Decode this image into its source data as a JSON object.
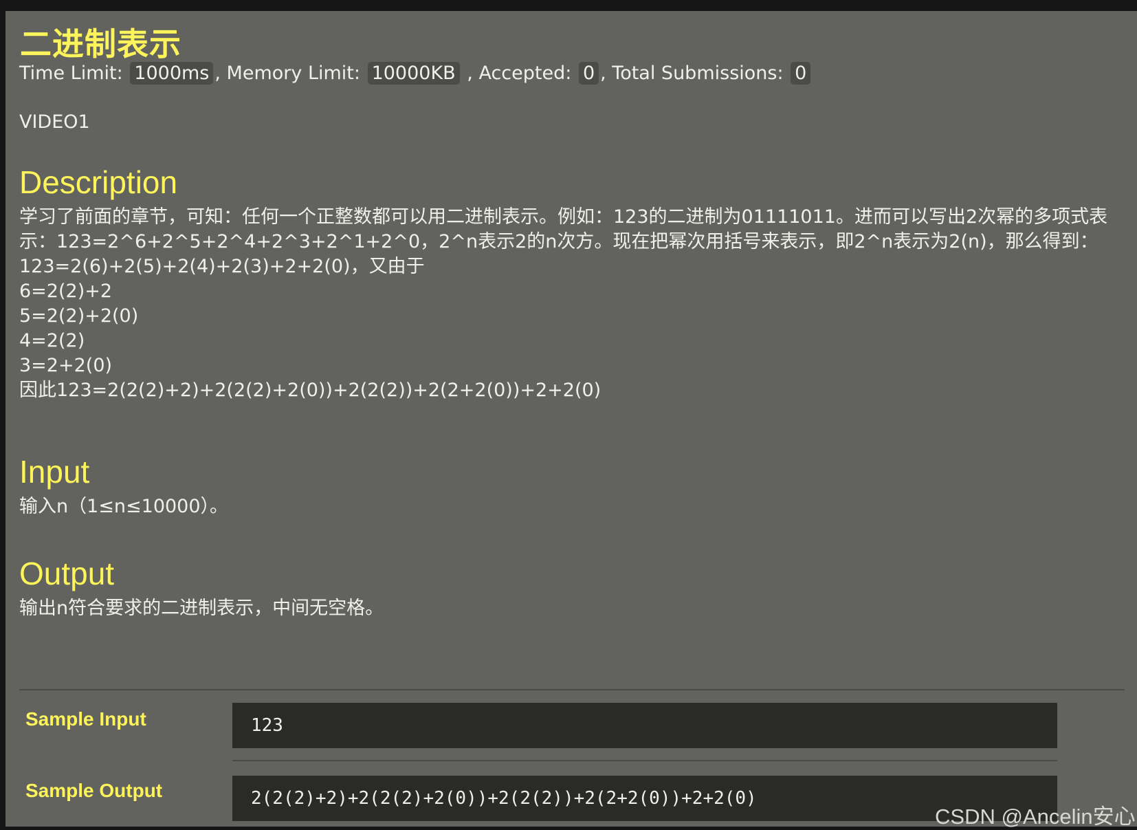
{
  "problem": {
    "title": "二进制表示",
    "limits": {
      "time_label": "Time Limit:",
      "time_value": "1000ms",
      "memory_label": ", Memory Limit:",
      "memory_value": "10000KB",
      "accepted_label": ", Accepted:",
      "accepted_value": "0",
      "total_label": ", Total Submissions:",
      "total_value": "0"
    },
    "source": "VIDEO1"
  },
  "description": {
    "heading": "Description",
    "paragraph": "学习了前面的章节，可知：任何一个正整数都可以用二进制表示。例如：123的二进制为01111011。进而可以写出2次幂的多项式表示：123=2^6+2^5+2^4+2^3+2^1+2^0，2^n表示2的n次方。现在把幂次用括号来表示，即2^n表示为2(n)，那么得到：",
    "lines": [
      "123=2(6)+2(5)+2(4)+2(3)+2+2(0)，又由于",
      "6=2(2)+2",
      "5=2(2)+2(0)",
      "4=2(2)",
      "3=2+2(0)",
      "因此123=2(2(2)+2)+2(2(2)+2(0))+2(2(2))+2(2+2(0))+2+2(0)"
    ]
  },
  "input": {
    "heading": "Input",
    "text": "输入n（1≤n≤10000）。"
  },
  "output": {
    "heading": "Output",
    "text": "输出n符合要求的二进制表示，中间无空格。"
  },
  "samples": {
    "input_label": "Sample Input",
    "input_value": "123",
    "output_label": "Sample Output",
    "output_value": "2(2(2)+2)+2(2(2)+2(0))+2(2(2))+2(2+2(0))+2+2(0)"
  },
  "watermark": "CSDN @Ancelin安心"
}
